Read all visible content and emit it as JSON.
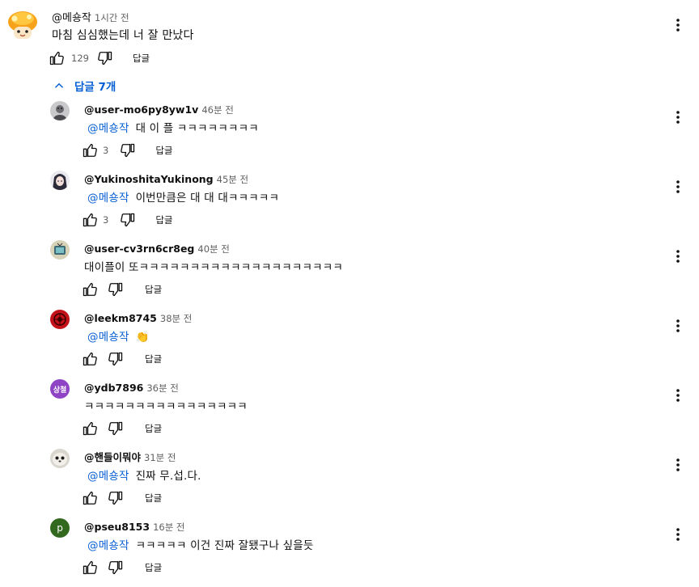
{
  "top_comment": {
    "author": "@메숑작",
    "time": "1시간 전",
    "text": "마침 심심했는데 너 잘 만났다",
    "likes": "129",
    "reply_label": "답글"
  },
  "replies_toggle": {
    "label": "답글 7개"
  },
  "replies": [
    {
      "author": "@user-mo6py8yw1v",
      "time": "46분 전",
      "mention": "@메숑작",
      "text": "대 이 플 ㅋㅋㅋㅋㅋㅋㅋㅋ",
      "likes": "3",
      "reply_label": "답글",
      "avatar": "gray-person-avatar"
    },
    {
      "author": "@YukinoshitaYukinong",
      "time": "45분 전",
      "mention": "@메숑작",
      "text": "이번만큼은 대 대 대ㅋㅋㅋㅋㅋ",
      "likes": "3",
      "reply_label": "답글",
      "avatar": "anime-avatar"
    },
    {
      "author": "@user-cv3rn6cr8eg",
      "time": "40분 전",
      "mention": "",
      "text": "대이플이 또ㅋㅋㅋㅋㅋㅋㅋㅋㅋㅋㅋㅋㅋㅋㅋㅋㅋㅋㅋㅋ",
      "likes": "",
      "reply_label": "답글",
      "avatar": "tv-avatar"
    },
    {
      "author": "@leekm8745",
      "time": "38분 전",
      "mention": "@메숑작",
      "text": "👏",
      "likes": "",
      "reply_label": "답글",
      "avatar": "red-emblem-avatar"
    },
    {
      "author": "@ydb7896",
      "time": "36분 전",
      "mention": "",
      "text": "ㅋㅋㅋㅋㅋㅋㅋㅋㅋㅋㅋㅋㅋㅋㅋㅋ",
      "likes": "",
      "reply_label": "답글",
      "avatar": "purple-letter-avatar",
      "avatar_text": "상철"
    },
    {
      "author": "@핸들이뭐야",
      "time": "31분 전",
      "mention": "@메숑작",
      "text": "진짜 무.섭.다.",
      "likes": "",
      "reply_label": "답글",
      "avatar": "seal-avatar"
    },
    {
      "author": "@pseu8153",
      "time": "16분 전",
      "mention": "@메숑작",
      "text": "ㅋㅋㅋㅋㅋ 이건 진짜 잘됐구나 싶을듯",
      "likes": "",
      "reply_label": "답글",
      "avatar": "green-letter-avatar",
      "avatar_text": "p"
    }
  ],
  "colors": {
    "link": "#065fd4",
    "text": "#0f0f0f",
    "secondary": "#606060"
  }
}
